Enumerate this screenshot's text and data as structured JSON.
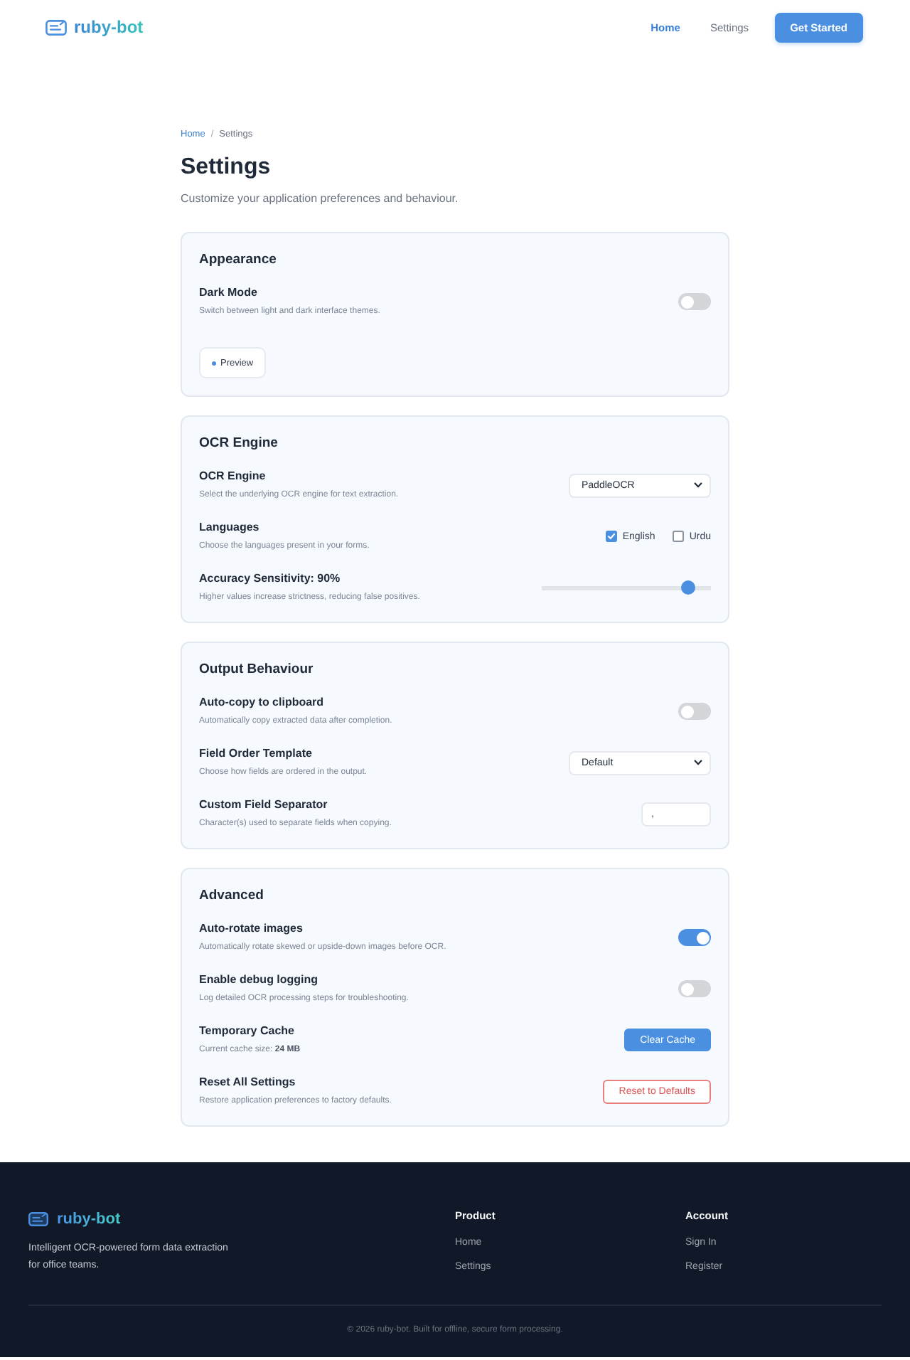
{
  "header": {
    "logo": "ruby-bot",
    "nav": [
      {
        "label": "Home",
        "selected": true
      },
      {
        "label": "Settings",
        "selected": false
      }
    ],
    "cta": "Get Started"
  },
  "breadcrumb": {
    "items": [
      {
        "label": "Home",
        "kind": "link"
      },
      {
        "label": "Settings",
        "kind": "current"
      }
    ],
    "separator": "/"
  },
  "page": {
    "title": "Settings",
    "subtitle": "Customize your application preferences and behaviour."
  },
  "sections": [
    {
      "title": "Appearance",
      "rows": [
        {
          "kind": "toggle",
          "label": "Dark Mode",
          "description": "Switch between light and dark interface themes.",
          "on": false
        },
        {
          "kind": "preview",
          "button": "Preview"
        }
      ]
    },
    {
      "title": "OCR Engine",
      "rows": [
        {
          "kind": "select",
          "label": "OCR Engine",
          "description": "Select the underlying OCR engine for text extraction.",
          "value": "PaddleOCR"
        },
        {
          "kind": "checkboxes",
          "label": "Languages",
          "description": "Choose the languages present in your forms.",
          "options": [
            {
              "label": "English",
              "checked": true
            },
            {
              "label": "Urdu",
              "checked": false
            }
          ]
        },
        {
          "kind": "slider",
          "label": "Accuracy Sensitivity: 90%",
          "description": "Higher values increase strictness, reducing false positives.",
          "level": 0.9
        }
      ]
    },
    {
      "title": "Output Behaviour",
      "rows": [
        {
          "kind": "toggle",
          "label": "Auto-copy to clipboard",
          "description": "Automatically copy extracted data after completion.",
          "on": false
        },
        {
          "kind": "select",
          "label": "Field Order Template",
          "description": "Choose how fields are ordered in the output.",
          "value": "Default"
        },
        {
          "kind": "text",
          "label": "Custom Field Separator",
          "description": "Character(s) used to separate fields when copying.",
          "value": ","
        }
      ]
    },
    {
      "title": "Advanced",
      "rows": [
        {
          "kind": "toggle",
          "label": "Auto-rotate images",
          "description": "Automatically rotate skewed or upside-down images before OCR.",
          "on": true
        },
        {
          "kind": "toggle",
          "label": "Enable debug logging",
          "description": "Log detailed OCR processing steps for troubleshooting.",
          "on": false
        },
        {
          "kind": "action",
          "label": "Temporary Cache",
          "description": "Current cache size: **24 MB**",
          "button": "Clear Cache"
        },
        {
          "kind": "reset",
          "label": "Reset All Settings",
          "description": "Restore application preferences to factory defaults.",
          "button": "Reset to Defaults"
        }
      ]
    }
  ],
  "footer": {
    "logo": "ruby-bot",
    "tagline": "Intelligent OCR-powered form data extraction for office teams.",
    "columns": [
      {
        "title": "Product",
        "links": [
          "Home",
          "Settings"
        ]
      },
      {
        "title": "Account",
        "links": [
          "Sign In",
          "Register"
        ]
      }
    ],
    "copyright": "© 2026 ruby-bot. Built for offline, secure form processing."
  }
}
